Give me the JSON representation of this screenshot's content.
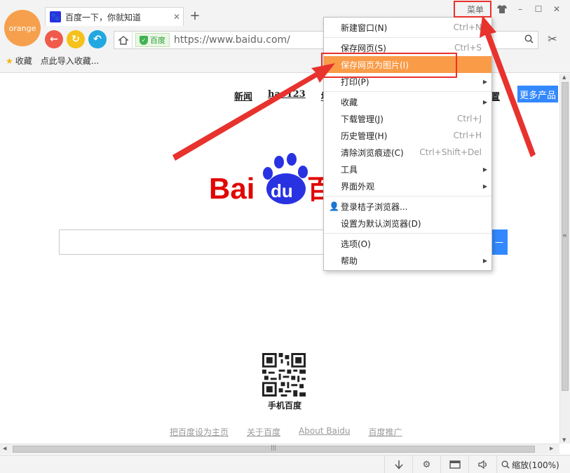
{
  "app": {
    "logo_text": "orange"
  },
  "tab": {
    "title": "百度一下，你就知道",
    "favicon": "baidu-paw-icon",
    "close": "✕",
    "new_tab": "+"
  },
  "window": {
    "menu_label": "菜单",
    "skin_icon": "shirt-icon",
    "minimize": "–",
    "maximize": "☐",
    "close": "✕"
  },
  "nav": {
    "back": "←",
    "refresh": "↻",
    "undo": "↶"
  },
  "address": {
    "home_icon": "home-icon",
    "secure_label": "百度",
    "url": "https://www.baidu.com/",
    "search_icon": "🔍"
  },
  "toolbar": {
    "scissors": "✂"
  },
  "favorites": {
    "items": [
      "收藏",
      "点此导入收藏..."
    ]
  },
  "page": {
    "top_links": [
      "新闻",
      "hao123",
      "地"
    ],
    "settings_link": "置",
    "more_button": "更多产品",
    "qr_label": "手机百度",
    "footer_links": [
      "把百度设为主页",
      "关于百度",
      "About Baidu",
      "百度推广"
    ],
    "search_button": "一"
  },
  "logo": {
    "bai": "Bai",
    "du": "du",
    "bai_char": "百"
  },
  "menu": {
    "items": [
      {
        "label": "新建窗口(N)",
        "shortcut": "Ctrl+N"
      },
      {
        "label": "保存网页(S)",
        "shortcut": "Ctrl+S"
      },
      {
        "label": "保存网页为图片(I)",
        "shortcut": ""
      },
      {
        "label": "打印(P)",
        "shortcut": ""
      },
      {
        "label": "收藏",
        "shortcut": ""
      },
      {
        "label": "下载管理(J)",
        "shortcut": "Ctrl+J"
      },
      {
        "label": "历史管理(H)",
        "shortcut": "Ctrl+H"
      },
      {
        "label": "清除浏览痕迹(C)",
        "shortcut": "Ctrl+Shift+Del"
      },
      {
        "label": "工具",
        "shortcut": ""
      },
      {
        "label": "界面外观",
        "shortcut": ""
      },
      {
        "label": "登录桔子浏览器...",
        "shortcut": ""
      },
      {
        "label": "设置为默认浏览器(D)",
        "shortcut": ""
      },
      {
        "label": "选项(O)",
        "shortcut": ""
      },
      {
        "label": "帮助",
        "shortcut": ""
      }
    ]
  },
  "status": {
    "zoom": "缩放(100%)"
  },
  "colors": {
    "highlight": "#f99b47",
    "annotation": "#e8322d",
    "baidu_red": "#e10602",
    "baidu_blue": "#2932e1"
  }
}
